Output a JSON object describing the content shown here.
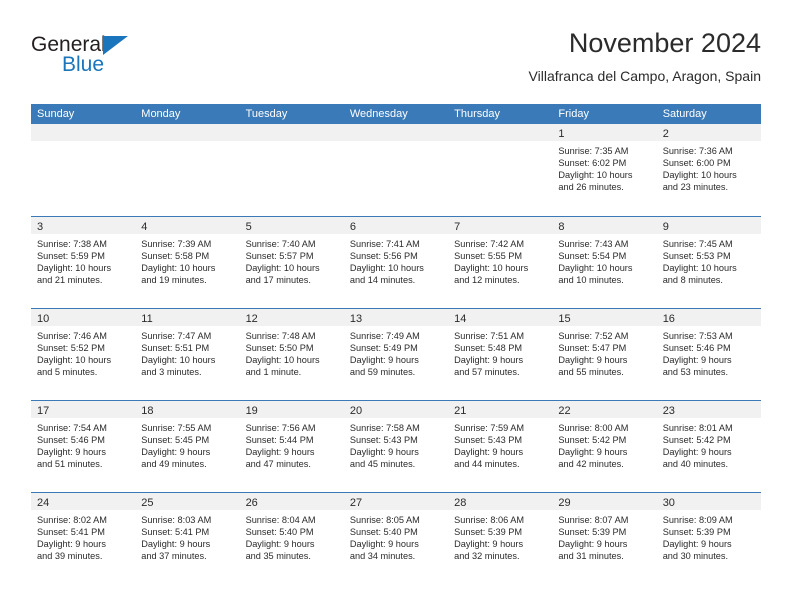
{
  "brand": {
    "name_top": "General",
    "name_bottom": "Blue",
    "accent_color": "#1a75bc",
    "triangle_icon": "brand-triangle-icon"
  },
  "header": {
    "title": "November 2024",
    "subtitle": "Villafranca del Campo, Aragon, Spain"
  },
  "colors": {
    "header_blue": "#3a7ab8",
    "day_band_gray": "#f1f1f1",
    "text": "#2b2b2b"
  },
  "weekdays": [
    "Sunday",
    "Monday",
    "Tuesday",
    "Wednesday",
    "Thursday",
    "Friday",
    "Saturday"
  ],
  "weeks": [
    [
      {
        "day": "",
        "sunrise": "",
        "sunset": "",
        "daylight_line1": "",
        "daylight_line2": ""
      },
      {
        "day": "",
        "sunrise": "",
        "sunset": "",
        "daylight_line1": "",
        "daylight_line2": ""
      },
      {
        "day": "",
        "sunrise": "",
        "sunset": "",
        "daylight_line1": "",
        "daylight_line2": ""
      },
      {
        "day": "",
        "sunrise": "",
        "sunset": "",
        "daylight_line1": "",
        "daylight_line2": ""
      },
      {
        "day": "",
        "sunrise": "",
        "sunset": "",
        "daylight_line1": "",
        "daylight_line2": ""
      },
      {
        "day": "1",
        "sunrise": "Sunrise: 7:35 AM",
        "sunset": "Sunset: 6:02 PM",
        "daylight_line1": "Daylight: 10 hours",
        "daylight_line2": "and 26 minutes."
      },
      {
        "day": "2",
        "sunrise": "Sunrise: 7:36 AM",
        "sunset": "Sunset: 6:00 PM",
        "daylight_line1": "Daylight: 10 hours",
        "daylight_line2": "and 23 minutes."
      }
    ],
    [
      {
        "day": "3",
        "sunrise": "Sunrise: 7:38 AM",
        "sunset": "Sunset: 5:59 PM",
        "daylight_line1": "Daylight: 10 hours",
        "daylight_line2": "and 21 minutes."
      },
      {
        "day": "4",
        "sunrise": "Sunrise: 7:39 AM",
        "sunset": "Sunset: 5:58 PM",
        "daylight_line1": "Daylight: 10 hours",
        "daylight_line2": "and 19 minutes."
      },
      {
        "day": "5",
        "sunrise": "Sunrise: 7:40 AM",
        "sunset": "Sunset: 5:57 PM",
        "daylight_line1": "Daylight: 10 hours",
        "daylight_line2": "and 17 minutes."
      },
      {
        "day": "6",
        "sunrise": "Sunrise: 7:41 AM",
        "sunset": "Sunset: 5:56 PM",
        "daylight_line1": "Daylight: 10 hours",
        "daylight_line2": "and 14 minutes."
      },
      {
        "day": "7",
        "sunrise": "Sunrise: 7:42 AM",
        "sunset": "Sunset: 5:55 PM",
        "daylight_line1": "Daylight: 10 hours",
        "daylight_line2": "and 12 minutes."
      },
      {
        "day": "8",
        "sunrise": "Sunrise: 7:43 AM",
        "sunset": "Sunset: 5:54 PM",
        "daylight_line1": "Daylight: 10 hours",
        "daylight_line2": "and 10 minutes."
      },
      {
        "day": "9",
        "sunrise": "Sunrise: 7:45 AM",
        "sunset": "Sunset: 5:53 PM",
        "daylight_line1": "Daylight: 10 hours",
        "daylight_line2": "and 8 minutes."
      }
    ],
    [
      {
        "day": "10",
        "sunrise": "Sunrise: 7:46 AM",
        "sunset": "Sunset: 5:52 PM",
        "daylight_line1": "Daylight: 10 hours",
        "daylight_line2": "and 5 minutes."
      },
      {
        "day": "11",
        "sunrise": "Sunrise: 7:47 AM",
        "sunset": "Sunset: 5:51 PM",
        "daylight_line1": "Daylight: 10 hours",
        "daylight_line2": "and 3 minutes."
      },
      {
        "day": "12",
        "sunrise": "Sunrise: 7:48 AM",
        "sunset": "Sunset: 5:50 PM",
        "daylight_line1": "Daylight: 10 hours",
        "daylight_line2": "and 1 minute."
      },
      {
        "day": "13",
        "sunrise": "Sunrise: 7:49 AM",
        "sunset": "Sunset: 5:49 PM",
        "daylight_line1": "Daylight: 9 hours",
        "daylight_line2": "and 59 minutes."
      },
      {
        "day": "14",
        "sunrise": "Sunrise: 7:51 AM",
        "sunset": "Sunset: 5:48 PM",
        "daylight_line1": "Daylight: 9 hours",
        "daylight_line2": "and 57 minutes."
      },
      {
        "day": "15",
        "sunrise": "Sunrise: 7:52 AM",
        "sunset": "Sunset: 5:47 PM",
        "daylight_line1": "Daylight: 9 hours",
        "daylight_line2": "and 55 minutes."
      },
      {
        "day": "16",
        "sunrise": "Sunrise: 7:53 AM",
        "sunset": "Sunset: 5:46 PM",
        "daylight_line1": "Daylight: 9 hours",
        "daylight_line2": "and 53 minutes."
      }
    ],
    [
      {
        "day": "17",
        "sunrise": "Sunrise: 7:54 AM",
        "sunset": "Sunset: 5:46 PM",
        "daylight_line1": "Daylight: 9 hours",
        "daylight_line2": "and 51 minutes."
      },
      {
        "day": "18",
        "sunrise": "Sunrise: 7:55 AM",
        "sunset": "Sunset: 5:45 PM",
        "daylight_line1": "Daylight: 9 hours",
        "daylight_line2": "and 49 minutes."
      },
      {
        "day": "19",
        "sunrise": "Sunrise: 7:56 AM",
        "sunset": "Sunset: 5:44 PM",
        "daylight_line1": "Daylight: 9 hours",
        "daylight_line2": "and 47 minutes."
      },
      {
        "day": "20",
        "sunrise": "Sunrise: 7:58 AM",
        "sunset": "Sunset: 5:43 PM",
        "daylight_line1": "Daylight: 9 hours",
        "daylight_line2": "and 45 minutes."
      },
      {
        "day": "21",
        "sunrise": "Sunrise: 7:59 AM",
        "sunset": "Sunset: 5:43 PM",
        "daylight_line1": "Daylight: 9 hours",
        "daylight_line2": "and 44 minutes."
      },
      {
        "day": "22",
        "sunrise": "Sunrise: 8:00 AM",
        "sunset": "Sunset: 5:42 PM",
        "daylight_line1": "Daylight: 9 hours",
        "daylight_line2": "and 42 minutes."
      },
      {
        "day": "23",
        "sunrise": "Sunrise: 8:01 AM",
        "sunset": "Sunset: 5:42 PM",
        "daylight_line1": "Daylight: 9 hours",
        "daylight_line2": "and 40 minutes."
      }
    ],
    [
      {
        "day": "24",
        "sunrise": "Sunrise: 8:02 AM",
        "sunset": "Sunset: 5:41 PM",
        "daylight_line1": "Daylight: 9 hours",
        "daylight_line2": "and 39 minutes."
      },
      {
        "day": "25",
        "sunrise": "Sunrise: 8:03 AM",
        "sunset": "Sunset: 5:41 PM",
        "daylight_line1": "Daylight: 9 hours",
        "daylight_line2": "and 37 minutes."
      },
      {
        "day": "26",
        "sunrise": "Sunrise: 8:04 AM",
        "sunset": "Sunset: 5:40 PM",
        "daylight_line1": "Daylight: 9 hours",
        "daylight_line2": "and 35 minutes."
      },
      {
        "day": "27",
        "sunrise": "Sunrise: 8:05 AM",
        "sunset": "Sunset: 5:40 PM",
        "daylight_line1": "Daylight: 9 hours",
        "daylight_line2": "and 34 minutes."
      },
      {
        "day": "28",
        "sunrise": "Sunrise: 8:06 AM",
        "sunset": "Sunset: 5:39 PM",
        "daylight_line1": "Daylight: 9 hours",
        "daylight_line2": "and 32 minutes."
      },
      {
        "day": "29",
        "sunrise": "Sunrise: 8:07 AM",
        "sunset": "Sunset: 5:39 PM",
        "daylight_line1": "Daylight: 9 hours",
        "daylight_line2": "and 31 minutes."
      },
      {
        "day": "30",
        "sunrise": "Sunrise: 8:09 AM",
        "sunset": "Sunset: 5:39 PM",
        "daylight_line1": "Daylight: 9 hours",
        "daylight_line2": "and 30 minutes."
      }
    ]
  ]
}
